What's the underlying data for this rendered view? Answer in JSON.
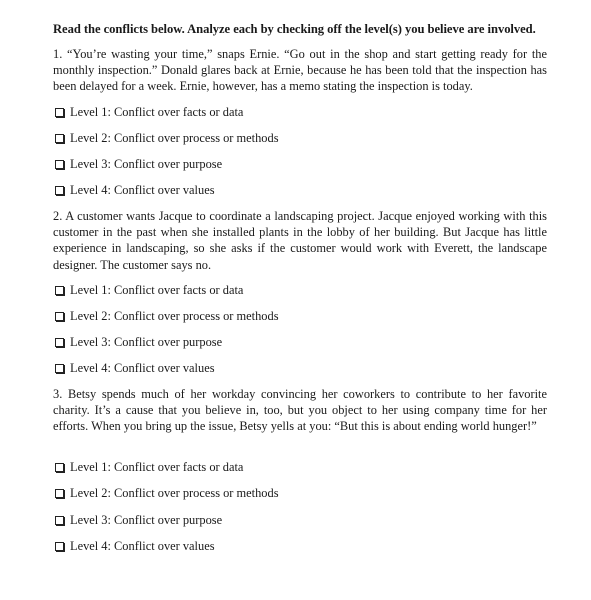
{
  "heading": "Read the conflicts below. Analyze each by checking off the level(s) you believe are involved.",
  "scenarios": [
    {
      "text": "1. “You’re wasting your time,” snaps Ernie. “Go out in the shop and start getting ready for the monthly inspection.” Donald glares back at Ernie, because he has been told that the inspection has been delayed for a week. Ernie, however, has a memo stating the inspection is today.",
      "options": [
        {
          "label": "Level 1: Conflict over facts or data",
          "checked": false
        },
        {
          "label": "Level 2: Conflict over process or methods",
          "checked": false
        },
        {
          "label": "Level 3: Conflict over purpose",
          "checked": false
        },
        {
          "label": "Level 4: Conflict over values",
          "checked": false
        }
      ]
    },
    {
      "text": "2. A customer wants Jacque to coordinate a landscaping project. Jacque enjoyed working with this customer in the past when she installed plants in the lobby of her building. But Jacque has little experience in landscaping, so she asks if the customer would work with Everett, the landscape designer. The customer says no.",
      "options": [
        {
          "label": "Level 1: Conflict over facts or data",
          "checked": false
        },
        {
          "label": "Level 2: Conflict over process or methods",
          "checked": false
        },
        {
          "label": "Level 3: Conflict over purpose",
          "checked": false
        },
        {
          "label": "Level 4: Conflict over values",
          "checked": false
        }
      ]
    },
    {
      "text": "3. Betsy spends much of her workday convincing her coworkers to contribute to her favorite charity. It’s a cause that you believe in, too, but you object to her using company time for her efforts. When you bring up the issue, Betsy yells at you: “But this is about ending world hunger!”",
      "options": [
        {
          "label": "Level 1: Conflict over facts or data",
          "checked": false
        },
        {
          "label": "Level 2: Conflict over process or methods",
          "checked": false
        },
        {
          "label": "Level 3: Conflict over purpose",
          "checked": false
        },
        {
          "label": "Level 4: Conflict over values",
          "checked": false
        }
      ]
    }
  ]
}
